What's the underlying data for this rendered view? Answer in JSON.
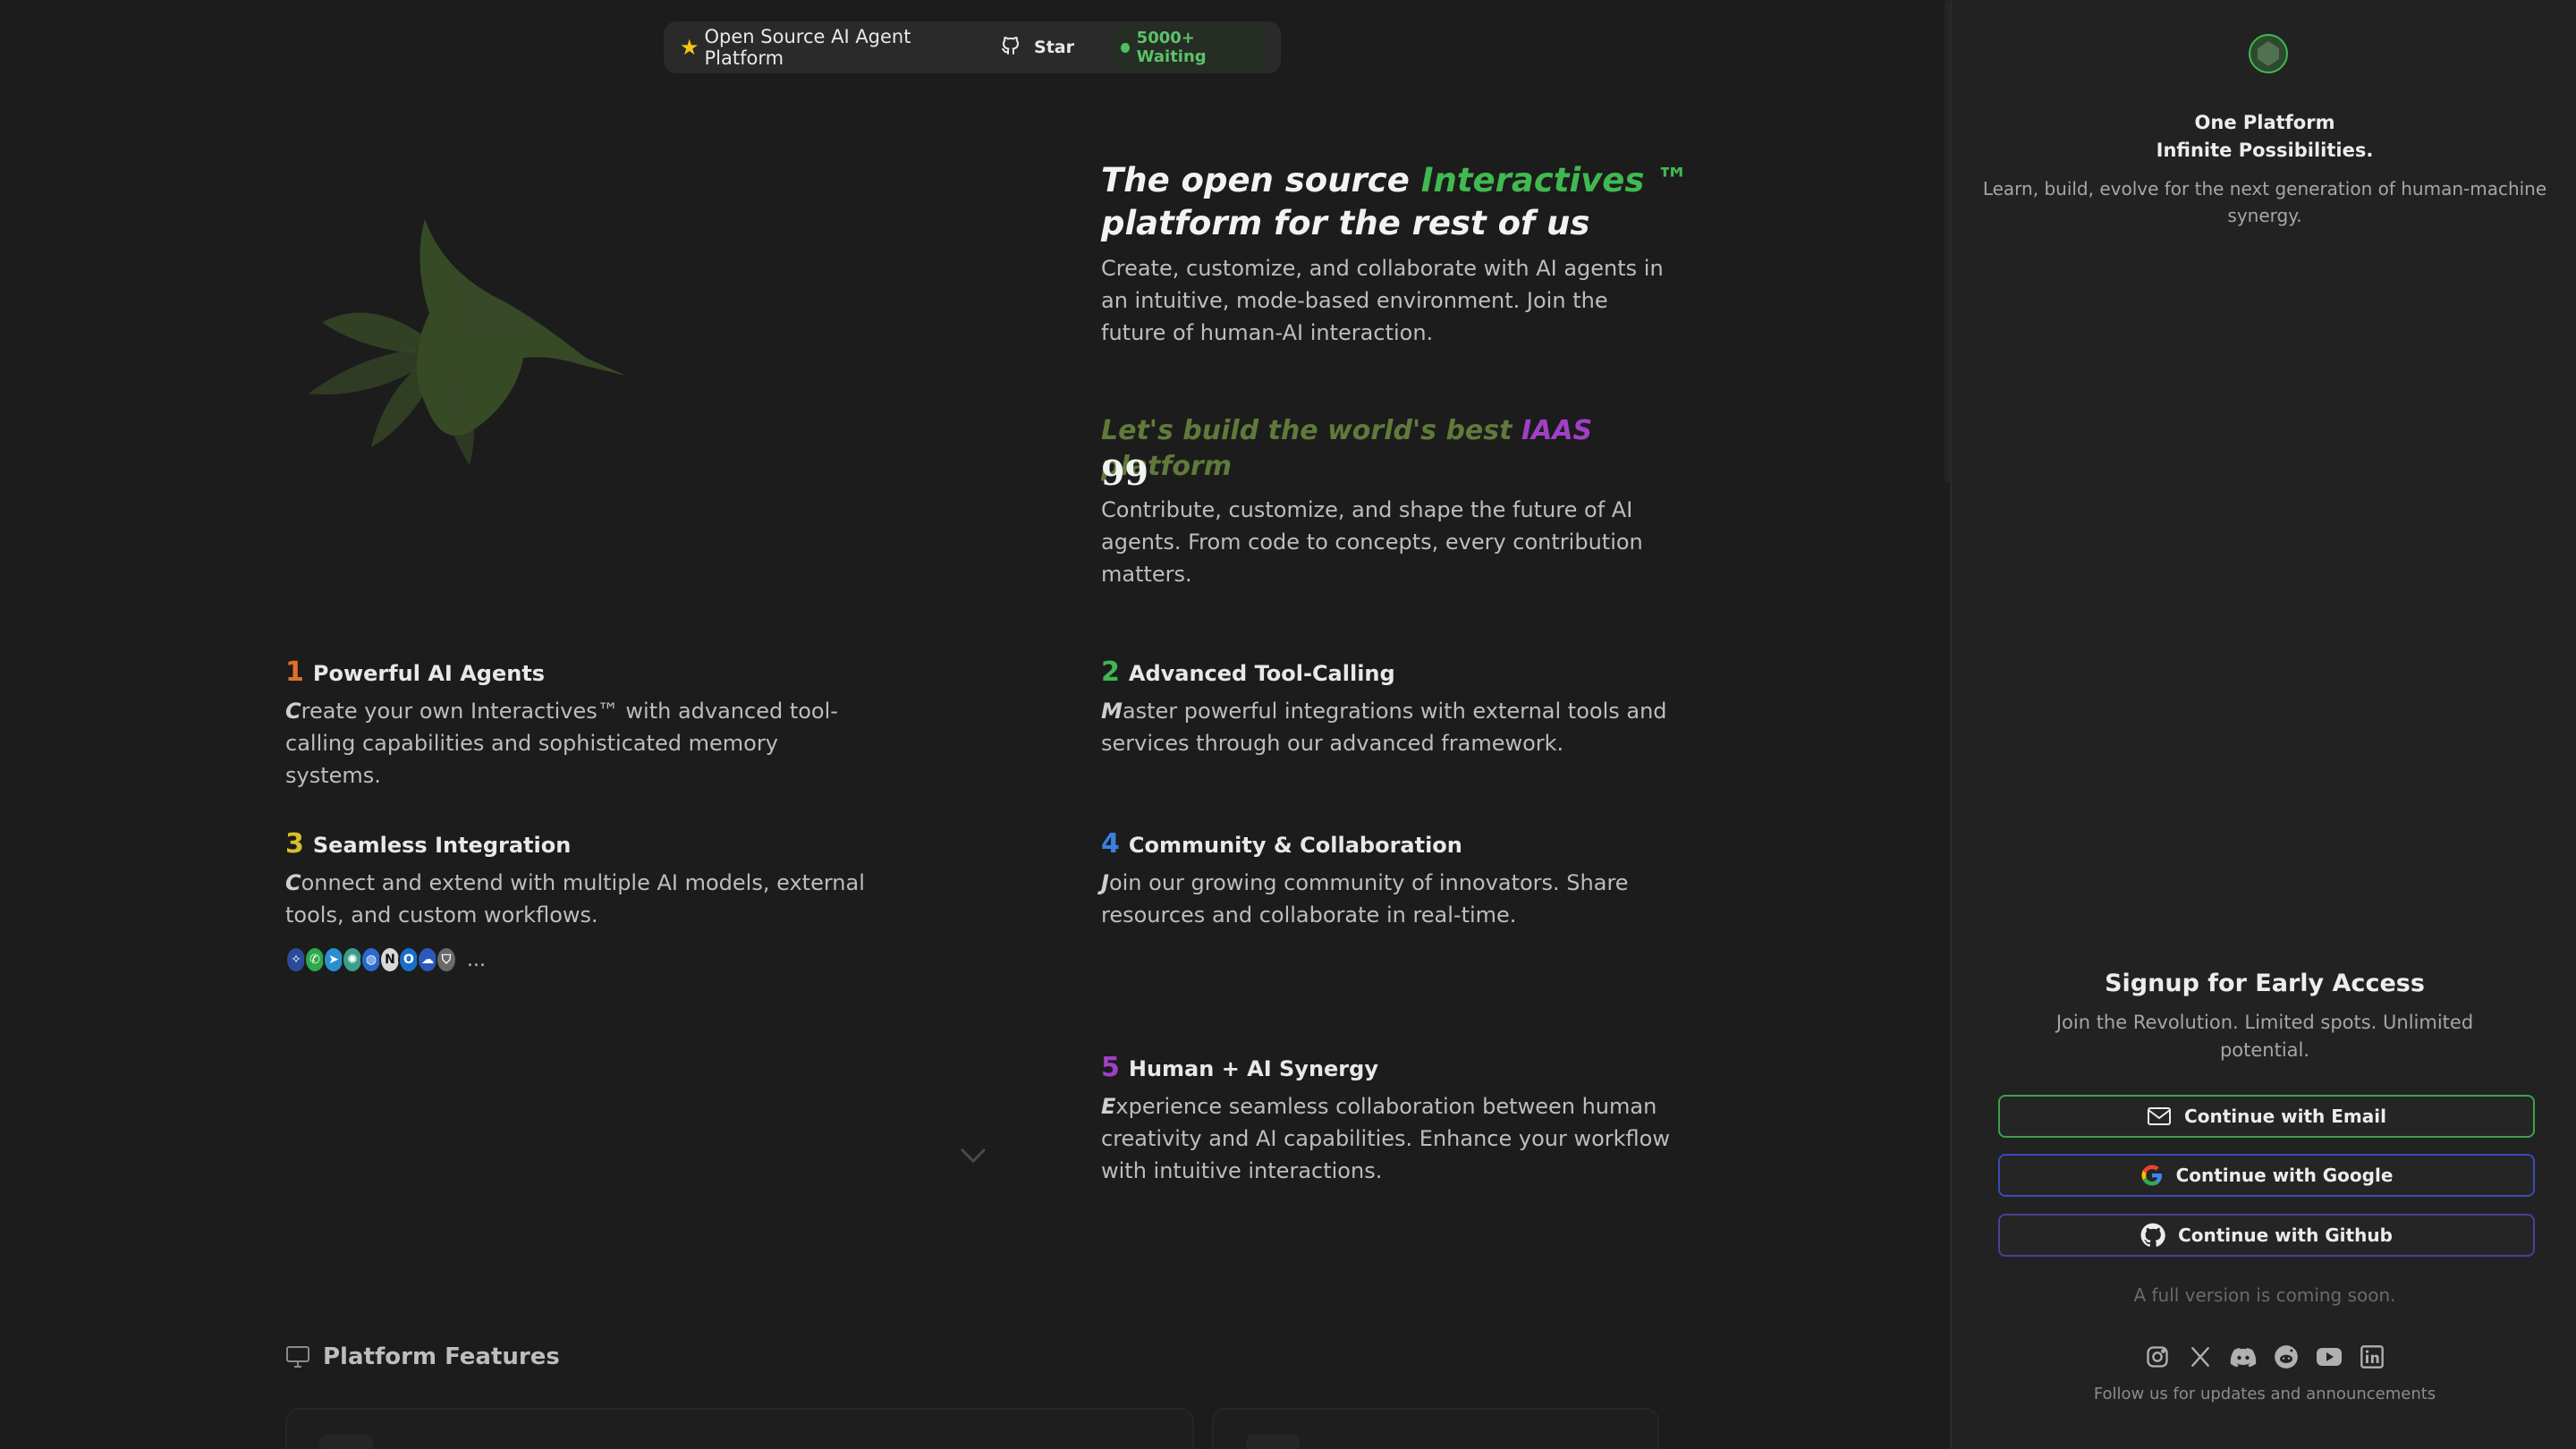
{
  "topbar": {
    "tagline": "Open Source AI Agent Platform",
    "star_label": "Star",
    "waiting_label": "5000+ Waiting"
  },
  "hero": {
    "title_prefix": "The open source",
    "title_highlight": "Interactives ™",
    "title_suffix": "platform for the rest of us",
    "description": "Create, customize, and collaborate with AI agents in an intuitive, mode-based environment. Join the future of human-AI interaction."
  },
  "quote": {
    "title_prefix": "Let's build the world's best",
    "title_highlight": "IAAS",
    "title_suffix": "platform",
    "mark": "99",
    "description": "Contribute, customize, and shape the future of AI agents. From code to concepts, every contribution matters."
  },
  "features": [
    {
      "num": "1",
      "color": "#e0702a",
      "title": "Powerful AI Agents",
      "cap": "C",
      "desc": "reate your own Interactives™ with advanced tool-calling capabilities and sophisticated memory systems."
    },
    {
      "num": "2",
      "color": "#3fb950",
      "title": "Advanced Tool-Calling",
      "cap": "M",
      "desc": "aster powerful integrations with external tools and services through our advanced framework."
    },
    {
      "num": "3",
      "color": "#d4c02a",
      "title": "Seamless Integration",
      "cap": "C",
      "desc": "onnect and extend with multiple AI models, external tools, and custom workflows."
    },
    {
      "num": "4",
      "color": "#3b7fe0",
      "title": "Community & Collaboration",
      "cap": "J",
      "desc": "oin our growing community of innovators. Share resources and collaborate in real-time."
    },
    {
      "num": "5",
      "color": "#a23fc8",
      "title": "Human + AI Synergy",
      "cap": "E",
      "desc": "xperience seamless collaboration between human creativity and AI capabilities. Enhance your workflow with intuitive interactions."
    }
  ],
  "integrations": {
    "more": "...",
    "chips": [
      {
        "icon": "ai-model-icon",
        "color": "#2b4a9a"
      },
      {
        "icon": "whatsapp-icon",
        "color": "#2ea84a"
      },
      {
        "icon": "telegram-icon",
        "color": "#2a8fd0"
      },
      {
        "icon": "openai-icon",
        "color": "#3a9e8a"
      },
      {
        "icon": "chat-icon",
        "color": "#2a6ad0"
      },
      {
        "icon": "notion-icon",
        "color": "#d8d8d8"
      },
      {
        "icon": "outlook-icon",
        "color": "#1a6ec8"
      },
      {
        "icon": "cloud-icon",
        "color": "#2a5ab8"
      },
      {
        "icon": "shield-icon",
        "color": "#6a6a6a"
      }
    ]
  },
  "platform_features": {
    "label": "Platform Features"
  },
  "side": {
    "tagline_line1": "One Platform",
    "tagline_line2": "Infinite Possibilities.",
    "subtitle": "Learn, build, evolve for the next generation of human-machine synergy.",
    "signup_title": "Signup for Early Access",
    "signup_desc": "Join the Revolution. Limited spots. Unlimited potential.",
    "btn_email": "Continue with Email",
    "btn_google": "Continue with Google",
    "btn_github": "Continue with Github",
    "coming_soon": "A full version is coming soon.",
    "follow": "Follow us for updates and announcements",
    "socials": [
      "instagram-icon",
      "x-icon",
      "discord-icon",
      "reddit-icon",
      "youtube-icon",
      "linkedin-icon"
    ]
  },
  "colors": {
    "accent_green": "#3fb950",
    "iaas_purple": "#a23fc8",
    "quote_olive": "#5f7a3a"
  }
}
